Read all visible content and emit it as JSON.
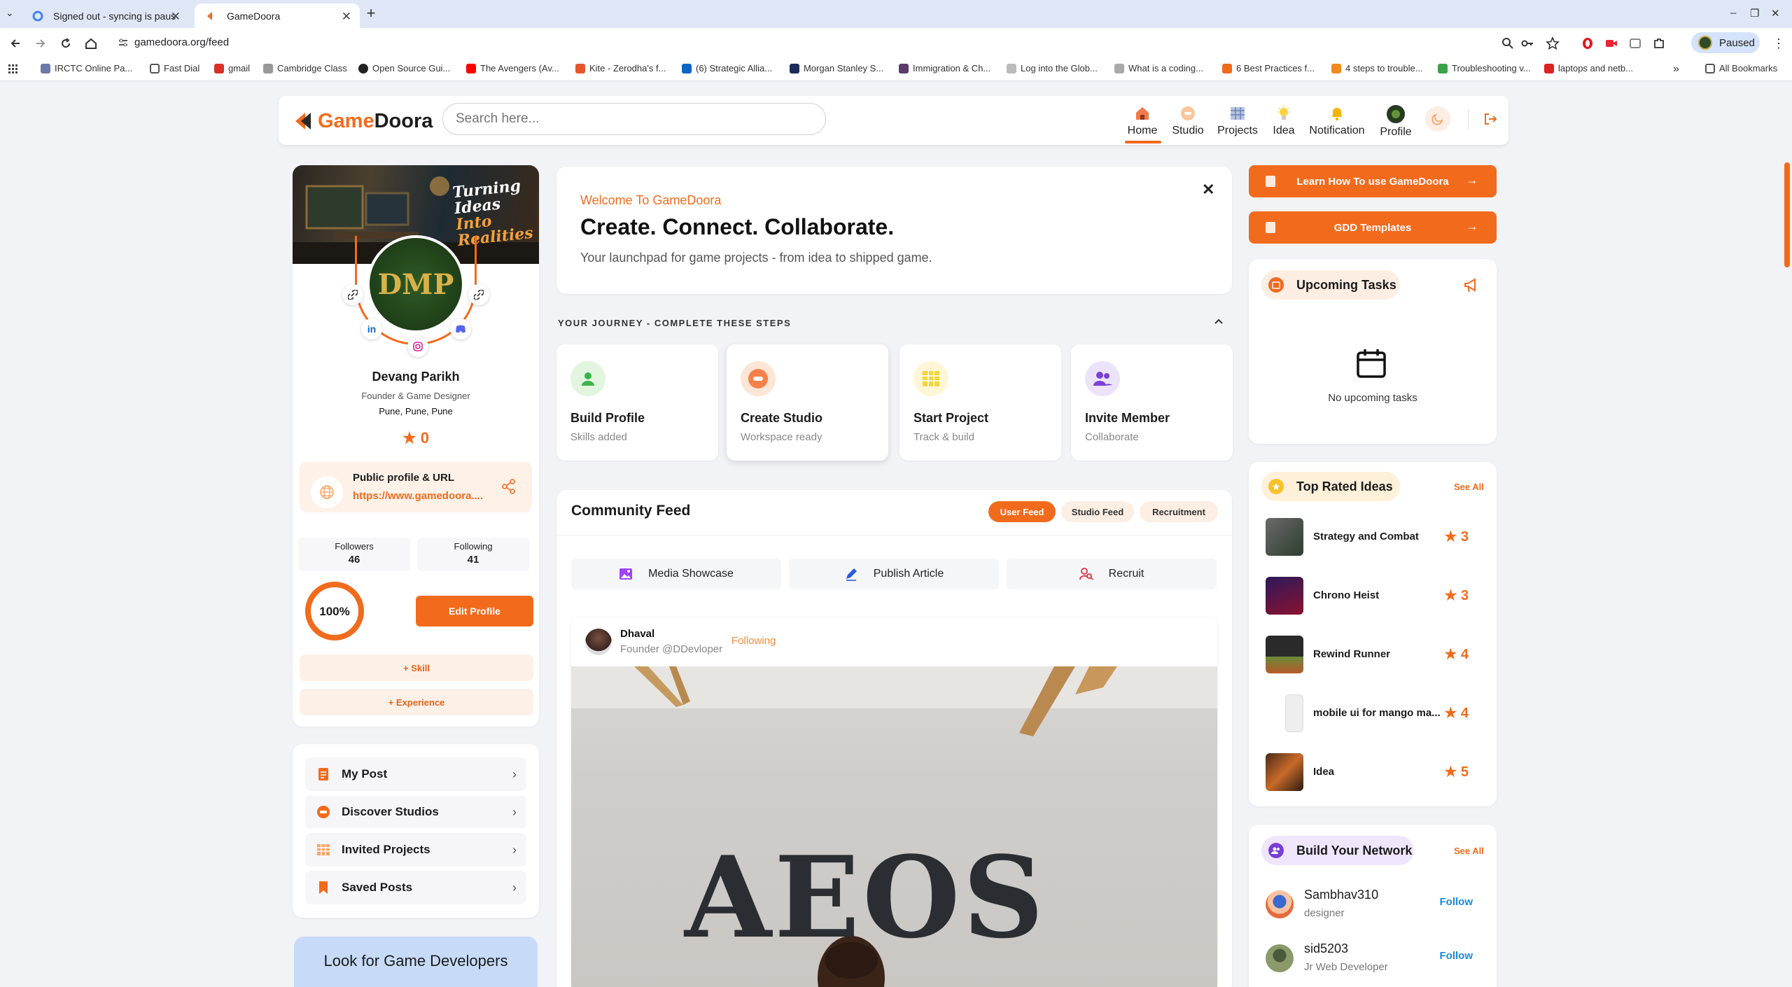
{
  "browser": {
    "tabs": [
      {
        "title": "Signed out - syncing is paus"
      },
      {
        "title": "GameDoora"
      }
    ],
    "url": "gamedoora.org/feed",
    "profile_button": "Paused",
    "bookmarks": [
      "IRCTC Online Pa...",
      "Fast Dial",
      "gmail",
      "Cambridge Class",
      "Open Source Gui...",
      "The Avengers (Av...",
      "Kite - Zerodha's f...",
      "(6) Strategic Allia...",
      "Morgan Stanley S...",
      "Immigration & Ch...",
      "Log into the Glob...",
      "What is a coding...",
      "6 Best Practices f...",
      "4 steps to trouble...",
      "Troubleshooting v...",
      "laptops and netb..."
    ],
    "all_bookmarks": "All Bookmarks"
  },
  "header": {
    "logo_pre": "Game",
    "logo_post": "Doora",
    "search_placeholder": "Search here...",
    "nav": [
      "Home",
      "Studio",
      "Projects",
      "Idea",
      "Notification",
      "Profile"
    ]
  },
  "profile": {
    "cover_text_1": "Turning Ideas",
    "cover_text_2": "Into Realities",
    "avatar_text": "DMP",
    "name": "Devang Parikh",
    "role": "Founder & Game Designer",
    "location": "Pune, Pune, Pune",
    "rating": "0",
    "public_label": "Public profile & URL",
    "public_link": "https://www.gamedoora....",
    "followers_label": "Followers",
    "followers": "46",
    "following_label": "Following",
    "following": "41",
    "completion": "100%",
    "completion_fraction": 1.0,
    "edit_label": "Edit Profile",
    "skill_label": "+ Skill",
    "experience_label": "+ Experience"
  },
  "menu": [
    {
      "label": "My Post"
    },
    {
      "label": "Discover Studios"
    },
    {
      "label": "Invited Projects"
    },
    {
      "label": "Saved Posts"
    }
  ],
  "look_card": "Look for Game Developers",
  "welcome": {
    "tag": "Welcome To GameDoora",
    "title": "Create. Connect. Collaborate.",
    "subtitle": "Your launchpad for game projects - from idea to shipped game."
  },
  "journey": {
    "heading": "YOUR JOURNEY - COMPLETE THESE STEPS",
    "steps": [
      {
        "title": "Build Profile",
        "sub": "Skills added"
      },
      {
        "title": "Create Studio",
        "sub": "Workspace ready"
      },
      {
        "title": "Start Project",
        "sub": "Track & build"
      },
      {
        "title": "Invite Member",
        "sub": "Collaborate"
      }
    ]
  },
  "feed": {
    "title": "Community Feed",
    "tabs": [
      "User Feed",
      "Studio Feed",
      "Recruitment"
    ],
    "actions": [
      "Media Showcase",
      "Publish Article",
      "Recruit"
    ],
    "post": {
      "author": "Dhaval",
      "role": "Founder @DDevloper",
      "follow": "Following",
      "image_text": "AEOS"
    }
  },
  "sidebar_right": {
    "learn_btn": "Learn How To use GameDoora",
    "gdd_btn": "GDD Templates",
    "tasks_title": "Upcoming Tasks",
    "no_tasks": "No upcoming tasks",
    "ideas_title": "Top Rated Ideas",
    "see_all": "See All",
    "ideas": [
      {
        "name": "Strategy and Combat",
        "rating": "3"
      },
      {
        "name": "Chrono Heist",
        "rating": "3"
      },
      {
        "name": "Rewind Runner",
        "rating": "4"
      },
      {
        "name": "mobile ui for mango ma...",
        "rating": "4"
      },
      {
        "name": "Idea",
        "rating": "5"
      }
    ],
    "network_title": "Build Your Network",
    "people": [
      {
        "name": "Sambhav310",
        "role": "designer",
        "action": "Follow"
      },
      {
        "name": "sid5203",
        "role": "Jr Web Developer",
        "action": "Follow"
      }
    ]
  },
  "colors": {
    "accent": "#f26b1d",
    "link_blue": "#1a8ad9",
    "bg": "#f2f3f6"
  }
}
